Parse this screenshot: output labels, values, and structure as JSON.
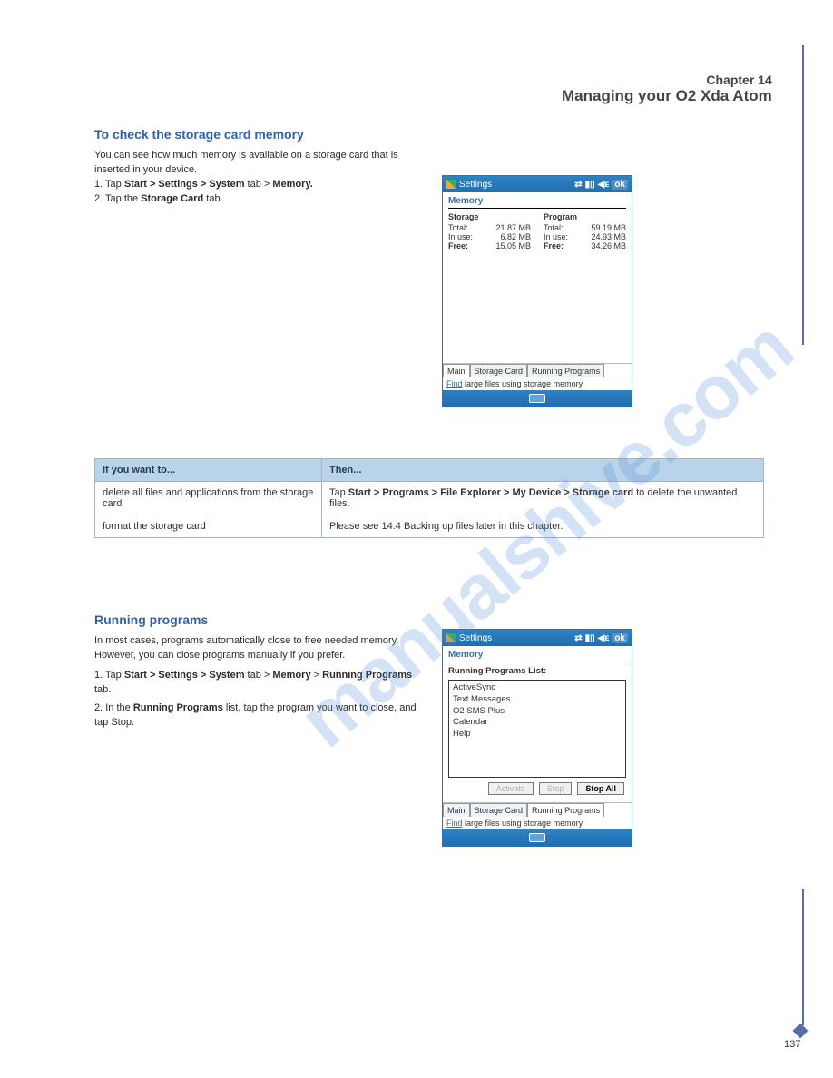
{
  "watermark": "manualshive.com",
  "page_number": "137",
  "chapter": {
    "num": "Chapter 14",
    "name": "Managing your O2 Xda Atom"
  },
  "section_aux": {
    "heading": "To check the storage card memory",
    "body_prefix": "You can see how much memory is available on a storage card that is inserted in your device.",
    "steps": "1. Tap ",
    "step1b": "Start > Settings > System",
    "step1c": " tab > ",
    "step1d": "Memory.",
    "step2a": "2. Tap the ",
    "step2b": "Storage Card",
    "step2c": " tab"
  },
  "shot1": {
    "title": "Settings",
    "ok": "ok",
    "screen_label": "Memory",
    "storage_h": "Storage",
    "program_h": "Program",
    "rows": {
      "total_l": "Total:",
      "total_s": "21.87 MB",
      "total_p": "59.19 MB",
      "inuse_l": "In use:",
      "inuse_s": "6.82 MB",
      "inuse_p": "24.93 MB",
      "free_l": "Free:",
      "free_s": "15.05 MB",
      "free_p": "34.26 MB"
    },
    "tabs": {
      "main": "Main",
      "storage": "Storage Card",
      "running": "Running Programs"
    },
    "find_text": "Find",
    "find_rest": " large files using storage memory."
  },
  "table": {
    "h1": "If you want to...",
    "h2": "Then...",
    "r1c1": "delete all files and applications from the storage card",
    "r1c2a": "Tap ",
    "r1c2b": "Start > Programs > File Explorer > My Device > Storage card",
    "r1c2c": " to delete the unwanted files.",
    "r2c1": "format the storage card",
    "r2c2": "Please see 14.4 Backing up files later in this chapter."
  },
  "section_run": {
    "heading": "Running programs",
    "body": "In most cases, programs automatically close to free needed memory. However, you can close programs manually if you prefer.",
    "s1a": "1. Tap ",
    "s1b": "Start > Settings > System",
    "s1c": " tab > ",
    "s1d": "Memory",
    "s1e": " > ",
    "s1f": "Running Programs",
    "s1g": " tab.",
    "s2a": "2. In the ",
    "s2b": "Running Programs",
    "s2c": " list, tap the program you want to close, and tap Stop."
  },
  "shot2": {
    "title": "Settings",
    "ok": "ok",
    "screen_label": "Memory",
    "list_label": "Running Programs List:",
    "items": [
      "ActiveSync",
      "Text Messages",
      "O2 SMS Plus",
      "Calendar",
      "Help"
    ],
    "btn_activate": "Activate",
    "btn_stop": "Stop",
    "btn_stopall": "Stop All",
    "tabs": {
      "main": "Main",
      "storage": "Storage Card",
      "running": "Running Programs"
    },
    "find_text": "Find",
    "find_rest": " large files using storage memory."
  }
}
